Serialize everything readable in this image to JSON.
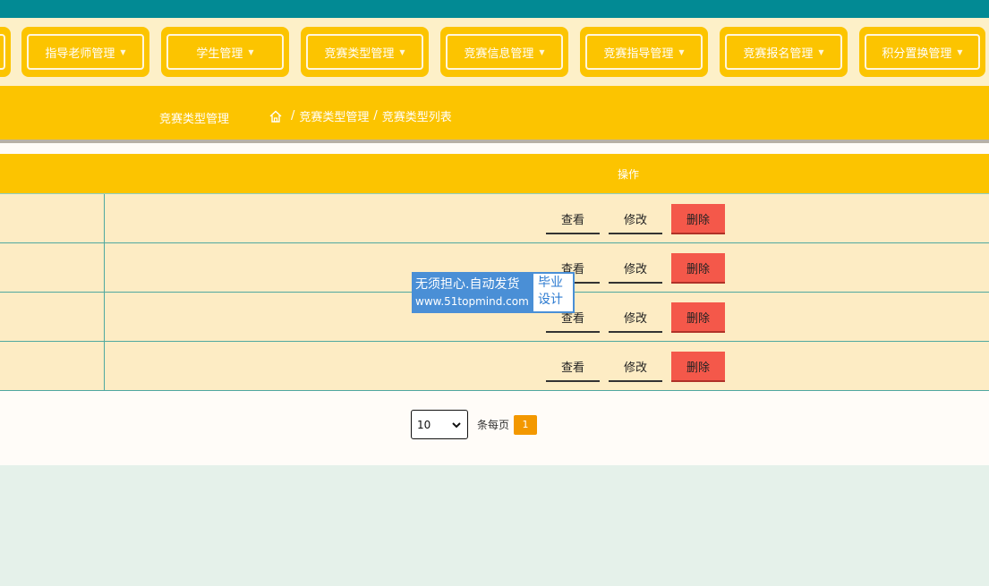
{
  "nav": {
    "items": [
      {
        "label": ""
      },
      {
        "label": "指导老师管理"
      },
      {
        "label": "学生管理"
      },
      {
        "label": "竞赛类型管理"
      },
      {
        "label": "竞赛信息管理"
      },
      {
        "label": "竞赛指导管理"
      },
      {
        "label": "竞赛报名管理"
      },
      {
        "label": "积分置换管理"
      }
    ]
  },
  "subheader": {
    "title": "竞赛类型管理",
    "breadcrumb": [
      "竞赛类型管理",
      "竞赛类型列表"
    ],
    "separator": "/"
  },
  "table": {
    "op_header": "操作",
    "rows": [
      {
        "view": "查看",
        "edit": "修改",
        "delete": "删除"
      },
      {
        "view": "查看",
        "edit": "修改",
        "delete": "删除"
      },
      {
        "view": "查看",
        "edit": "修改",
        "delete": "删除"
      },
      {
        "view": "查看",
        "edit": "修改",
        "delete": "删除"
      }
    ]
  },
  "pagination": {
    "page_size": "10",
    "per_page_label": "条每页",
    "current_page": "1"
  },
  "watermark": {
    "line1": "无须担心.自动发货",
    "line2": "www.51topmind.com",
    "side1": "毕业",
    "side2": "设计"
  },
  "colors": {
    "topbar": "#028a94",
    "accent": "#fcc400",
    "delete": "#f4584a",
    "page_active": "#f39800"
  },
  "icons": {
    "home": "home-icon",
    "caret": "caret-down-icon",
    "select": "chevron-down-icon"
  }
}
